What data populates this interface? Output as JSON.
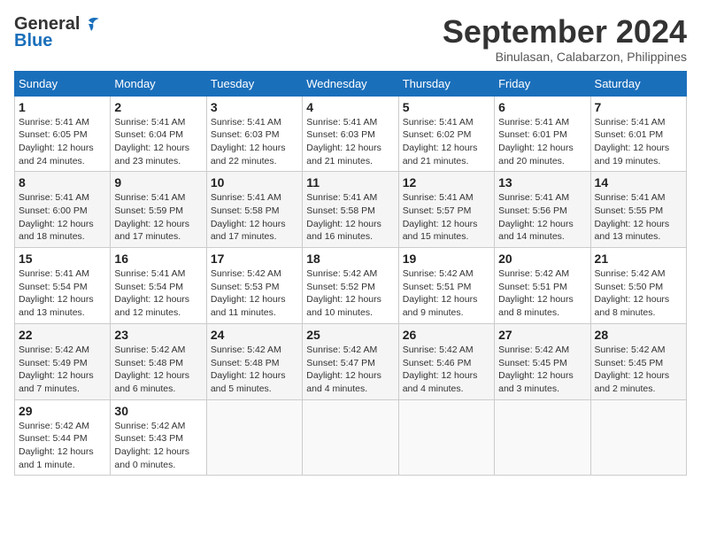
{
  "header": {
    "logo_general": "General",
    "logo_blue": "Blue",
    "month_title": "September 2024",
    "location": "Binulasan, Calabarzon, Philippines"
  },
  "weekdays": [
    "Sunday",
    "Monday",
    "Tuesday",
    "Wednesday",
    "Thursday",
    "Friday",
    "Saturday"
  ],
  "weeks": [
    [
      {
        "day": "1",
        "sunrise": "5:41 AM",
        "sunset": "6:05 PM",
        "daylight": "12 hours and 24 minutes."
      },
      {
        "day": "2",
        "sunrise": "5:41 AM",
        "sunset": "6:04 PM",
        "daylight": "12 hours and 23 minutes."
      },
      {
        "day": "3",
        "sunrise": "5:41 AM",
        "sunset": "6:03 PM",
        "daylight": "12 hours and 22 minutes."
      },
      {
        "day": "4",
        "sunrise": "5:41 AM",
        "sunset": "6:03 PM",
        "daylight": "12 hours and 21 minutes."
      },
      {
        "day": "5",
        "sunrise": "5:41 AM",
        "sunset": "6:02 PM",
        "daylight": "12 hours and 21 minutes."
      },
      {
        "day": "6",
        "sunrise": "5:41 AM",
        "sunset": "6:01 PM",
        "daylight": "12 hours and 20 minutes."
      },
      {
        "day": "7",
        "sunrise": "5:41 AM",
        "sunset": "6:01 PM",
        "daylight": "12 hours and 19 minutes."
      }
    ],
    [
      {
        "day": "8",
        "sunrise": "5:41 AM",
        "sunset": "6:00 PM",
        "daylight": "12 hours and 18 minutes."
      },
      {
        "day": "9",
        "sunrise": "5:41 AM",
        "sunset": "5:59 PM",
        "daylight": "12 hours and 17 minutes."
      },
      {
        "day": "10",
        "sunrise": "5:41 AM",
        "sunset": "5:58 PM",
        "daylight": "12 hours and 17 minutes."
      },
      {
        "day": "11",
        "sunrise": "5:41 AM",
        "sunset": "5:58 PM",
        "daylight": "12 hours and 16 minutes."
      },
      {
        "day": "12",
        "sunrise": "5:41 AM",
        "sunset": "5:57 PM",
        "daylight": "12 hours and 15 minutes."
      },
      {
        "day": "13",
        "sunrise": "5:41 AM",
        "sunset": "5:56 PM",
        "daylight": "12 hours and 14 minutes."
      },
      {
        "day": "14",
        "sunrise": "5:41 AM",
        "sunset": "5:55 PM",
        "daylight": "12 hours and 13 minutes."
      }
    ],
    [
      {
        "day": "15",
        "sunrise": "5:41 AM",
        "sunset": "5:54 PM",
        "daylight": "12 hours and 13 minutes."
      },
      {
        "day": "16",
        "sunrise": "5:41 AM",
        "sunset": "5:54 PM",
        "daylight": "12 hours and 12 minutes."
      },
      {
        "day": "17",
        "sunrise": "5:42 AM",
        "sunset": "5:53 PM",
        "daylight": "12 hours and 11 minutes."
      },
      {
        "day": "18",
        "sunrise": "5:42 AM",
        "sunset": "5:52 PM",
        "daylight": "12 hours and 10 minutes."
      },
      {
        "day": "19",
        "sunrise": "5:42 AM",
        "sunset": "5:51 PM",
        "daylight": "12 hours and 9 minutes."
      },
      {
        "day": "20",
        "sunrise": "5:42 AM",
        "sunset": "5:51 PM",
        "daylight": "12 hours and 8 minutes."
      },
      {
        "day": "21",
        "sunrise": "5:42 AM",
        "sunset": "5:50 PM",
        "daylight": "12 hours and 8 minutes."
      }
    ],
    [
      {
        "day": "22",
        "sunrise": "5:42 AM",
        "sunset": "5:49 PM",
        "daylight": "12 hours and 7 minutes."
      },
      {
        "day": "23",
        "sunrise": "5:42 AM",
        "sunset": "5:48 PM",
        "daylight": "12 hours and 6 minutes."
      },
      {
        "day": "24",
        "sunrise": "5:42 AM",
        "sunset": "5:48 PM",
        "daylight": "12 hours and 5 minutes."
      },
      {
        "day": "25",
        "sunrise": "5:42 AM",
        "sunset": "5:47 PM",
        "daylight": "12 hours and 4 minutes."
      },
      {
        "day": "26",
        "sunrise": "5:42 AM",
        "sunset": "5:46 PM",
        "daylight": "12 hours and 4 minutes."
      },
      {
        "day": "27",
        "sunrise": "5:42 AM",
        "sunset": "5:45 PM",
        "daylight": "12 hours and 3 minutes."
      },
      {
        "day": "28",
        "sunrise": "5:42 AM",
        "sunset": "5:45 PM",
        "daylight": "12 hours and 2 minutes."
      }
    ],
    [
      {
        "day": "29",
        "sunrise": "5:42 AM",
        "sunset": "5:44 PM",
        "daylight": "12 hours and 1 minute."
      },
      {
        "day": "30",
        "sunrise": "5:42 AM",
        "sunset": "5:43 PM",
        "daylight": "12 hours and 0 minutes."
      },
      null,
      null,
      null,
      null,
      null
    ]
  ]
}
